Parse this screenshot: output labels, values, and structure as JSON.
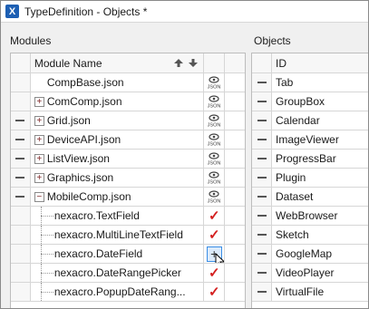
{
  "window": {
    "title": "TypeDefinition - Objects *"
  },
  "modules_panel": {
    "label": "Modules",
    "header": {
      "name_col": "Module Name"
    },
    "rows": [
      {
        "name": "CompBase.json",
        "indicator": "",
        "expander": "",
        "flag": "json-icon",
        "kind": "top"
      },
      {
        "name": "ComComp.json",
        "indicator": "",
        "expander": "+",
        "flag": "json-icon",
        "kind": "top"
      },
      {
        "name": "Grid.json",
        "indicator": "dash",
        "expander": "+",
        "flag": "json-icon",
        "kind": "top"
      },
      {
        "name": "DeviceAPI.json",
        "indicator": "dash",
        "expander": "+",
        "flag": "json-icon",
        "kind": "top"
      },
      {
        "name": "ListView.json",
        "indicator": "dash",
        "expander": "+",
        "flag": "json-icon",
        "kind": "top"
      },
      {
        "name": "Graphics.json",
        "indicator": "dash",
        "expander": "+",
        "flag": "json-icon",
        "kind": "top"
      },
      {
        "name": "MobileComp.json",
        "indicator": "dash",
        "expander": "−",
        "flag": "json-icon",
        "kind": "top"
      },
      {
        "name": "nexacro.TextField",
        "indicator": "",
        "expander": "",
        "flag": "check",
        "kind": "child"
      },
      {
        "name": "nexacro.MultiLineTextField",
        "indicator": "",
        "expander": "",
        "flag": "check",
        "kind": "child"
      },
      {
        "name": "nexacro.DateField",
        "indicator": "",
        "expander": "",
        "flag": "edit",
        "kind": "child"
      },
      {
        "name": "nexacro.DateRangePicker",
        "indicator": "",
        "expander": "",
        "flag": "check",
        "kind": "child"
      },
      {
        "name": "nexacro.PopupDateRang...",
        "indicator": "",
        "expander": "",
        "flag": "check",
        "kind": "child"
      }
    ]
  },
  "objects_panel": {
    "label": "Objects",
    "header": {
      "id_col": "ID"
    },
    "rows": [
      "Tab",
      "GroupBox",
      "Calendar",
      "ImageViewer",
      "ProgressBar",
      "Plugin",
      "Dataset",
      "WebBrowser",
      "Sketch",
      "GoogleMap",
      "VideoPlayer",
      "VirtualFile"
    ]
  },
  "symbols": {
    "check": "✓",
    "plus": "+"
  },
  "colors": {
    "check": "#d42020",
    "title_icon": "#1d5fb3",
    "selection_border": "#3a8ee6"
  }
}
